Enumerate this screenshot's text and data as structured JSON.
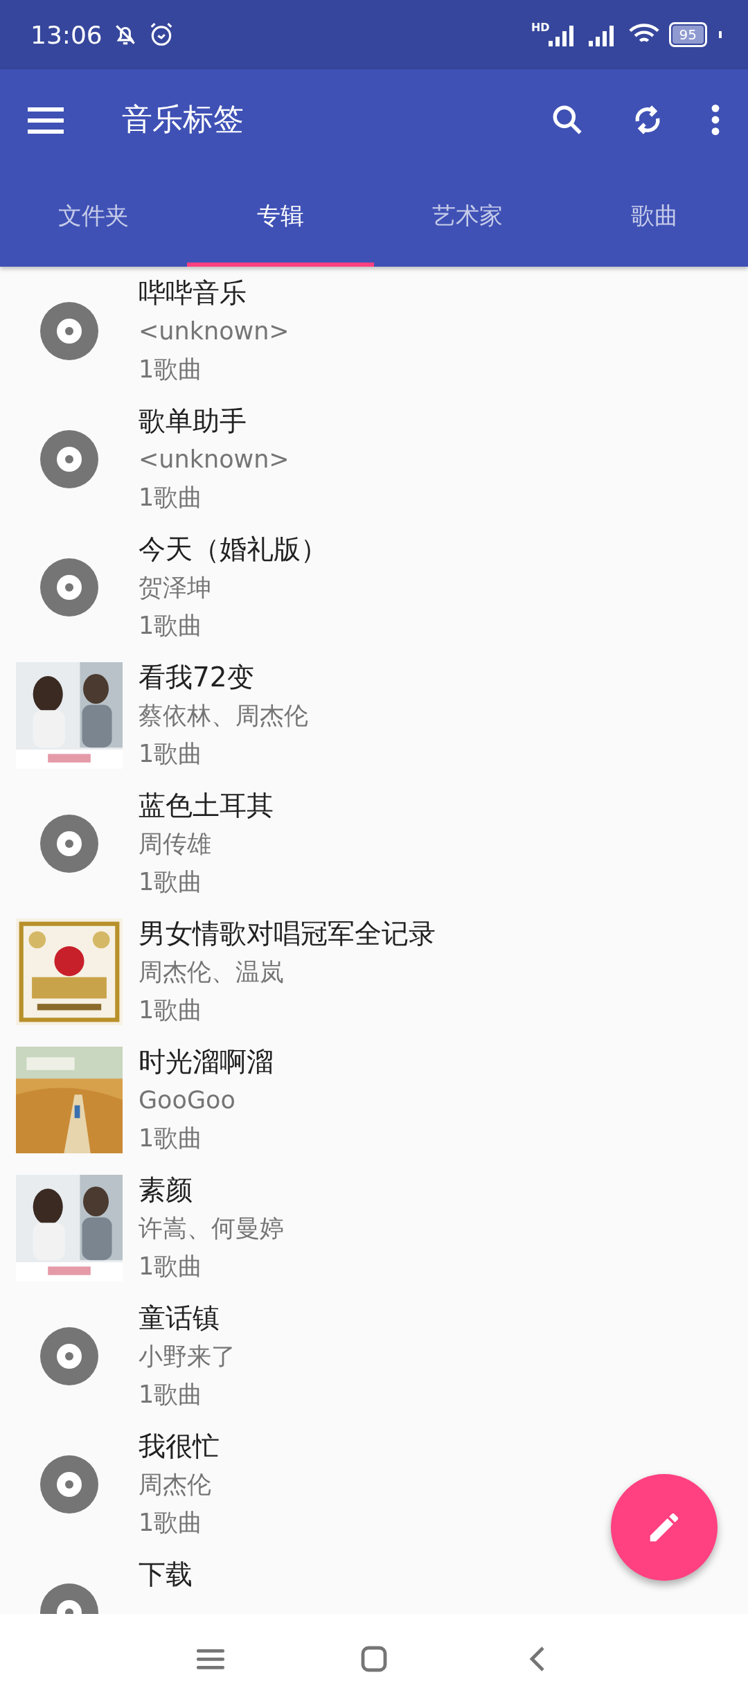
{
  "status_bar": {
    "time": "13:06",
    "network_label": "HD",
    "battery": "95"
  },
  "toolbar": {
    "title": "音乐标签"
  },
  "tabs": [
    {
      "label": "文件夹",
      "selected": false
    },
    {
      "label": "专辑",
      "selected": true
    },
    {
      "label": "艺术家",
      "selected": false
    },
    {
      "label": "歌曲",
      "selected": false
    }
  ],
  "albums": [
    {
      "kind": "disc",
      "title": "哔哔音乐",
      "artist": "<unknown>",
      "count": "1歌曲"
    },
    {
      "kind": "disc",
      "title": "歌单助手",
      "artist": "<unknown>",
      "count": "1歌曲"
    },
    {
      "kind": "disc",
      "title": "今天（婚礼版）",
      "artist": "贺泽坤",
      "count": "1歌曲"
    },
    {
      "kind": "picture",
      "title": "看我72变",
      "artist": "蔡依林、周杰伦",
      "count": "1歌曲"
    },
    {
      "kind": "disc",
      "title": "蓝色土耳其",
      "artist": "周传雄",
      "count": "1歌曲"
    },
    {
      "kind": "picture",
      "title": "男女情歌对唱冠军全记录",
      "artist": "周杰伦、温岚",
      "count": "1歌曲"
    },
    {
      "kind": "picture",
      "title": "时光溜啊溜",
      "artist": "GooGoo",
      "count": "1歌曲"
    },
    {
      "kind": "picture",
      "title": "素颜",
      "artist": "许嵩、何曼婷",
      "count": "1歌曲"
    },
    {
      "kind": "disc",
      "title": "童话镇",
      "artist": "小野来了",
      "count": "1歌曲"
    },
    {
      "kind": "disc",
      "title": "我很忙",
      "artist": "周杰伦",
      "count": "1歌曲"
    },
    {
      "kind": "disc",
      "title": "下载"
    }
  ]
}
